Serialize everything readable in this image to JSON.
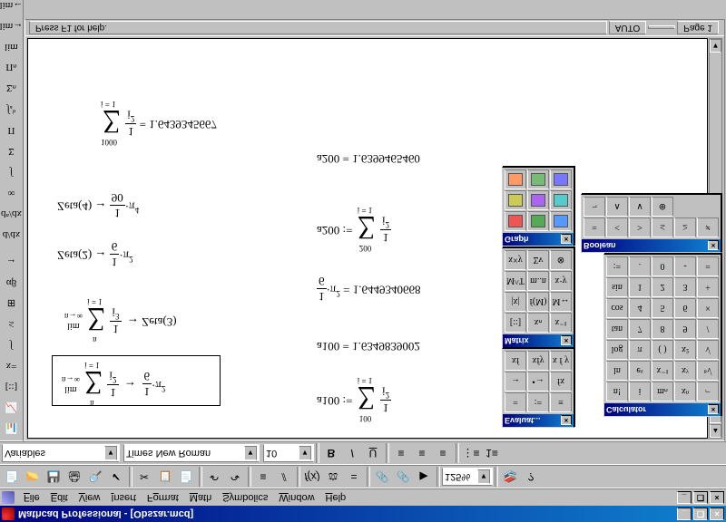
{
  "title": "Mathcad Professional - [Obszar.mcd]",
  "menus": [
    "File",
    "Edit",
    "View",
    "Insert",
    "Format",
    "Math",
    "Symbolics",
    "Window",
    "Help"
  ],
  "zoom": "125%",
  "font_combo": "Times New Roman",
  "size_combo": "10",
  "style_combo": "Variables",
  "status": {
    "help": "Press F1 for help.",
    "mode": "AUTO",
    "page": "Page 1"
  },
  "palettes": {
    "calculator": {
      "title": "Calculator",
      "buttons": [
        "n!",
        "i",
        "mₙ",
        "xⁿ",
        "⌐",
        "ln",
        "eˣ",
        "x⁻¹",
        "xʸ",
        "ⁿ√",
        "log",
        "π",
        "( )",
        "x²",
        "√",
        "tan",
        "7",
        "8",
        "9",
        "/",
        "cos",
        "4",
        "5",
        "6",
        "×",
        "sin",
        "1",
        "2",
        "3",
        "+",
        ":=",
        ".",
        "0",
        "-",
        "="
      ]
    },
    "boolean": {
      "title": "Boolean",
      "buttons": [
        "=",
        "<",
        ">",
        "≤",
        "≥",
        "≠",
        "¬",
        "∧",
        "∨",
        "⊕"
      ]
    },
    "matrix": {
      "title": "Matrix",
      "buttons": [
        "[::]",
        "xₙ",
        "x⁻¹",
        "|x|",
        "f(M)",
        "M↔",
        "M^T",
        "m..n",
        "x·y",
        "x×y",
        "Σv",
        "⊗"
      ]
    },
    "evaluation": {
      "title": "Evaluat...",
      "buttons": [
        "=",
        ":=",
        "≡",
        "→",
        "•→",
        "fx",
        "xf",
        "xfy",
        "x f y"
      ]
    },
    "graph": {
      "title": "Graph",
      "buttons": [
        "xy",
        "polar",
        "3d",
        "surf",
        "contour",
        "bar",
        "scatter",
        "vec",
        "pic"
      ]
    }
  },
  "equations": {
    "eq1_rhs": "1/6·π²",
    "a100_def_lower": "100",
    "a100_val": "a100 = 1.6349839002",
    "pi_val": "1/6·π² = 1.6449340668",
    "a200_def_lower": "200",
    "a200_val": "a200 = 1.6399465460",
    "zeta2": "Zeta(2) → 1/6·π²",
    "zeta4": "Zeta(4) → 1/90·π⁴",
    "sum1000_val": "= 1.6439345667",
    "sum1000_lower": "1000"
  }
}
